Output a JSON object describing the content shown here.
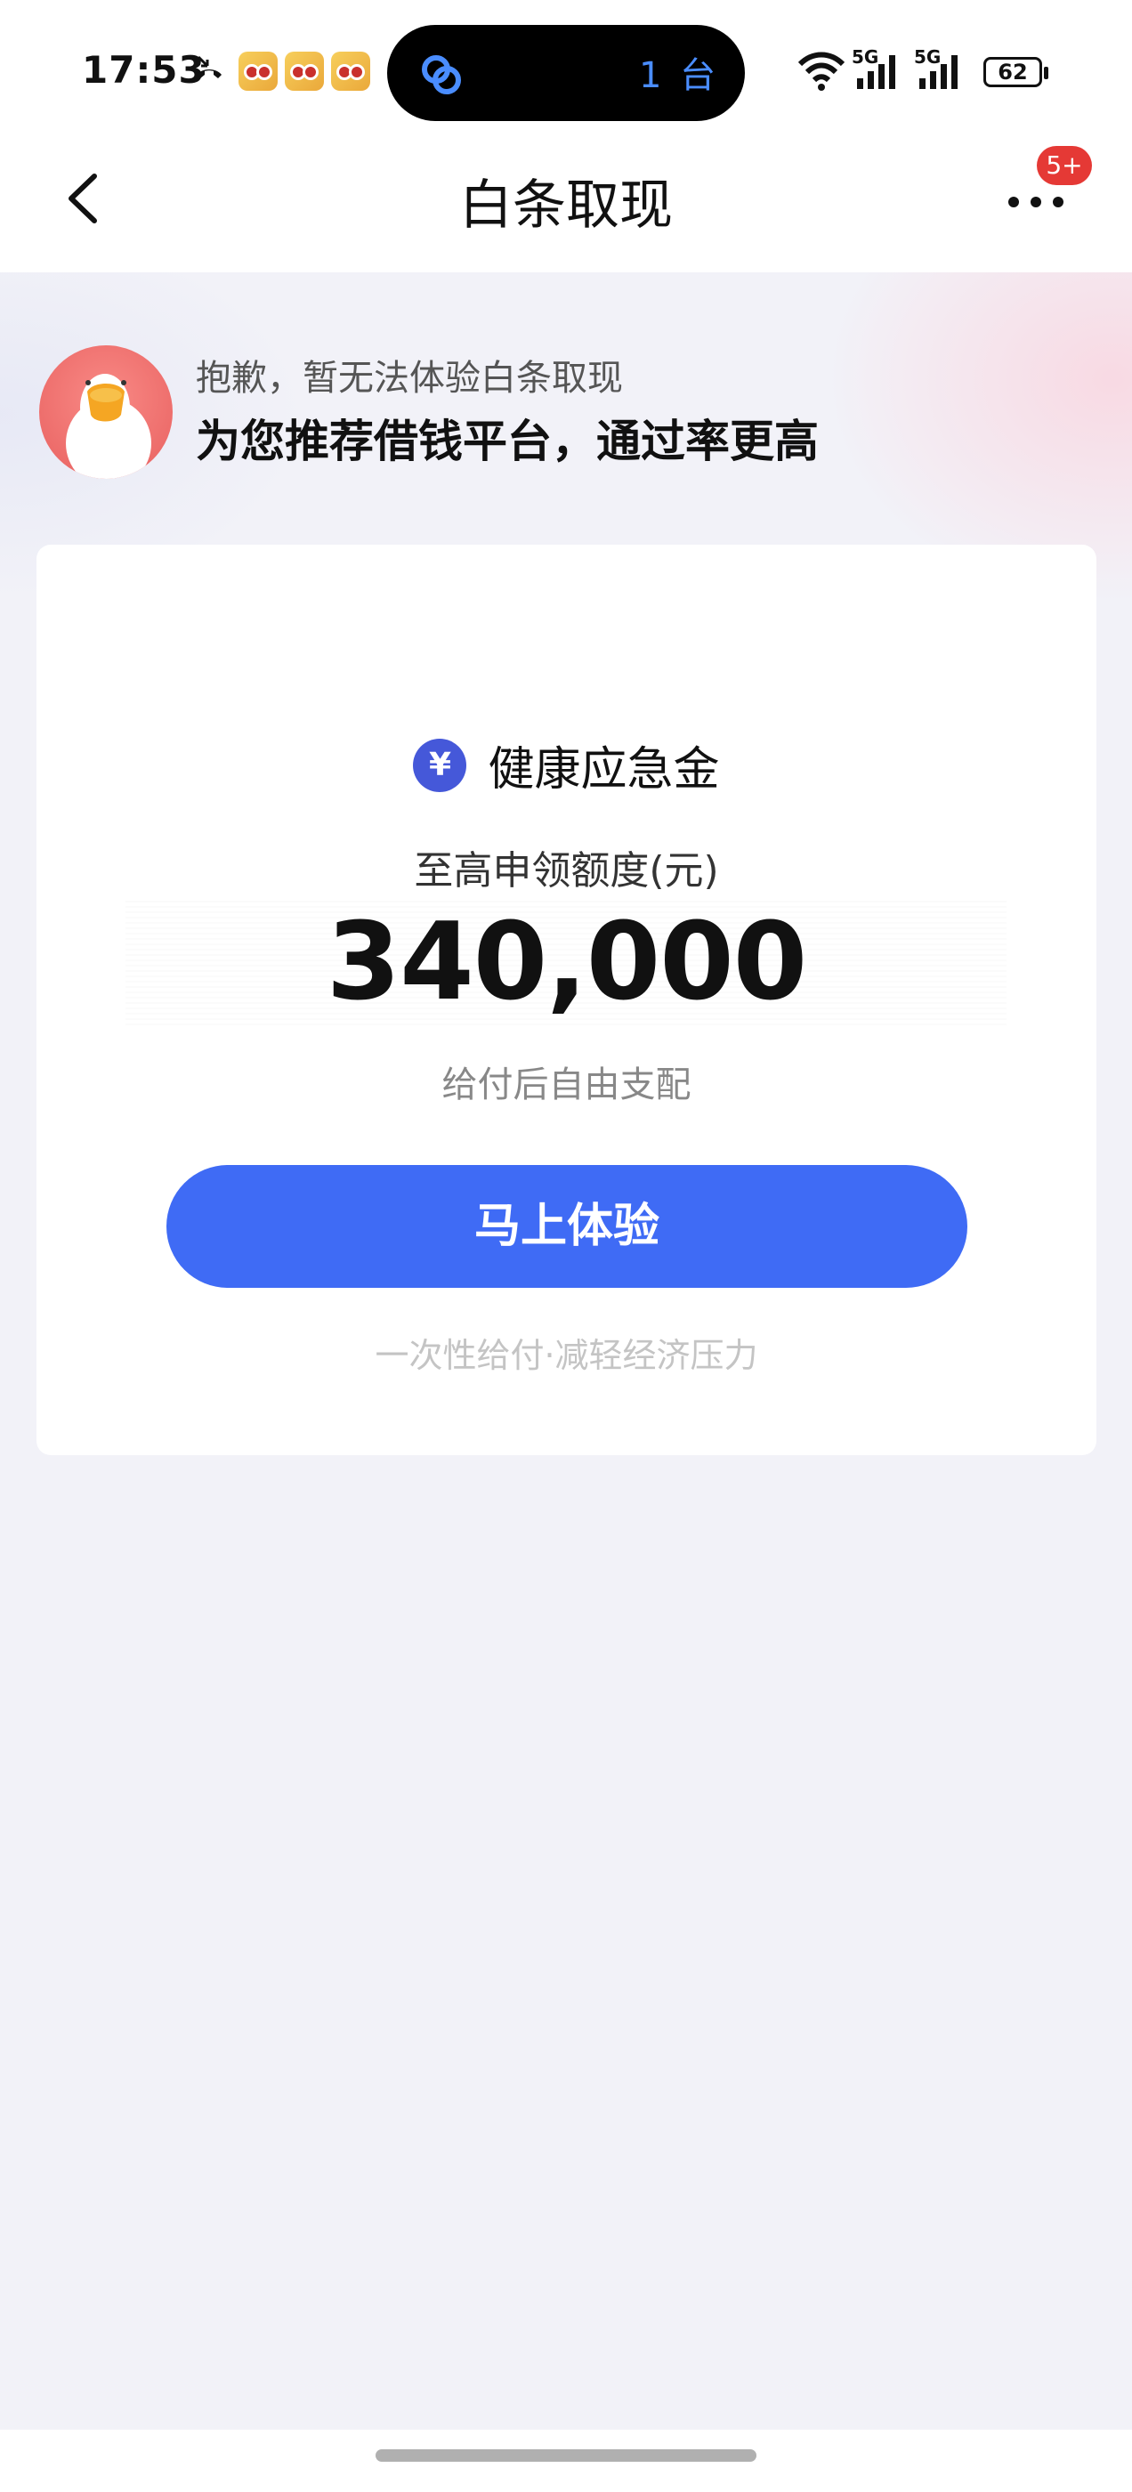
{
  "status_bar": {
    "time": "17:53",
    "island_count": "1 台",
    "battery": "62",
    "network_labels": [
      "5G",
      "5G"
    ]
  },
  "nav": {
    "title": "白条取现",
    "badge": "5+"
  },
  "notice": {
    "subtitle": "抱歉，暂无法体验白条取现",
    "title": "为您推荐借钱平台，通过率更高"
  },
  "card": {
    "product_icon": "¥",
    "product_name": "健康应急金",
    "limit_label": "至高申领额度(元)",
    "amount": "340,000",
    "amount_note": "给付后自由支配",
    "cta_label": "马上体验",
    "cta_note": "一次性给付·减轻经济压力"
  },
  "colors": {
    "accent": "#3f6bf5",
    "badge": "#e53935",
    "background": "#f2f2f8"
  }
}
